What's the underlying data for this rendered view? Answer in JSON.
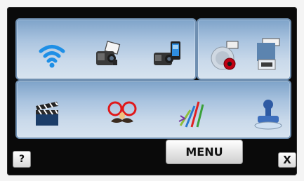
{
  "panels": {
    "top_left": {
      "title": "",
      "icons": [
        "wifi-icon",
        "camera-monitor-icon",
        "camcorder-phone-icon"
      ]
    },
    "top_right": {
      "title": "",
      "icons": [
        "disc-record-icon",
        "memory-card-icon"
      ]
    },
    "bottom": {
      "title": "",
      "icons": [
        "clapperboard-icon",
        "glasses-mustache-icon",
        "pencils-icon",
        "stamp-icon"
      ]
    }
  },
  "footer": {
    "help_label": "?",
    "menu_label": "MENU",
    "close_label": "X"
  },
  "colors": {
    "panel_border": "#6f8fb1",
    "panel_gradient_top": "#7ea3c9",
    "panel_gradient_bottom": "#d7e3ef",
    "wifi_blue": "#1e8fe6",
    "screen_bg": "#0a0a0a"
  }
}
